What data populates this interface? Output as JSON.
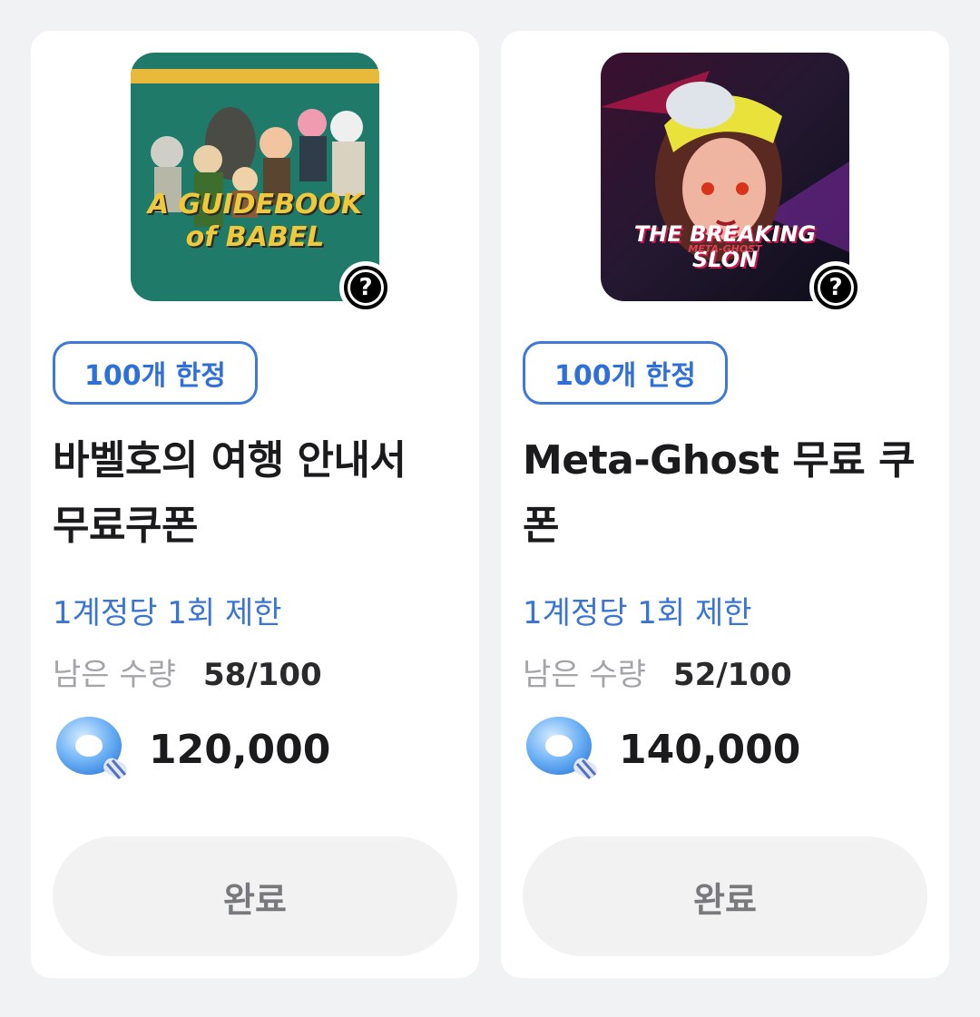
{
  "cards": [
    {
      "thumbnail_text": "A GUIDEBOOK of BABEL",
      "badge": "100개 한정",
      "title": "바벨호의 여행 안내서 무료쿠폰",
      "limit": "1계정당 1회 제한",
      "remain_label": "남은 수량",
      "remain_value": "58/100",
      "price": "120,000",
      "button_label": "완료"
    },
    {
      "thumbnail_text": "THE BREAKING SLON",
      "thumbnail_subtext": "META-GHOST",
      "badge": "100개 한정",
      "title": "Meta-Ghost 무료 쿠폰",
      "limit": "1계정당 1회 제한",
      "remain_label": "남은 수량",
      "remain_value": "52/100",
      "price": "140,000",
      "button_label": "완료"
    }
  ],
  "help_icon_glyph": "?",
  "currency_icon": "blue-ring-currency-icon",
  "colors": {
    "accent": "#3f78d6",
    "background": "#f1f2f4",
    "card": "#ffffff",
    "button_disabled_bg": "#f2f2f3"
  }
}
